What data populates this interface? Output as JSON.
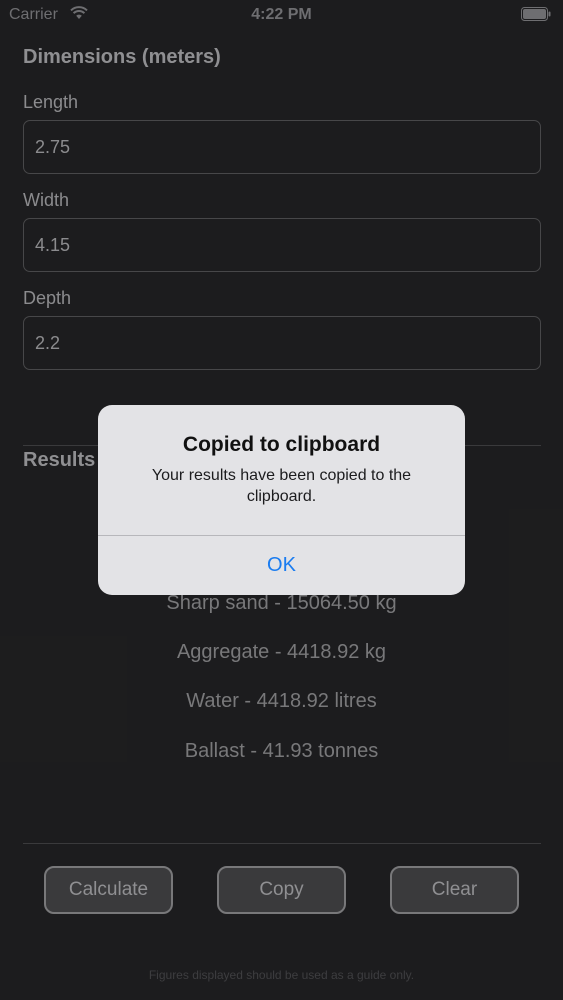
{
  "status_bar": {
    "carrier": "Carrier",
    "time": "4:22 PM",
    "icons": [
      "wifi-icon",
      "battery-icon"
    ]
  },
  "dimensions": {
    "title": "Dimensions (meters)",
    "length_label": "Length",
    "length_value": "2.75",
    "width_label": "Width",
    "width_value": "4.15",
    "depth_label": "Depth",
    "depth_value": "2.2"
  },
  "results": {
    "title": "Results",
    "lines": [
      "Sharp sand - 15064.50 kg",
      "Aggregate - 4418.92 kg",
      "Water - 4418.92 litres",
      "Ballast - 41.93 tonnes"
    ]
  },
  "buttons": {
    "calculate": "Calculate",
    "copy": "Copy",
    "clear": "Clear"
  },
  "footer": "Figures displayed should be used as a guide only.",
  "alert": {
    "title": "Copied to clipboard",
    "message": "Your results have been copied to the clipboard.",
    "ok_label": "OK"
  },
  "colors": {
    "background": "#252527",
    "alert_background": "#e3e3e6",
    "accent": "#1a7cf0"
  }
}
